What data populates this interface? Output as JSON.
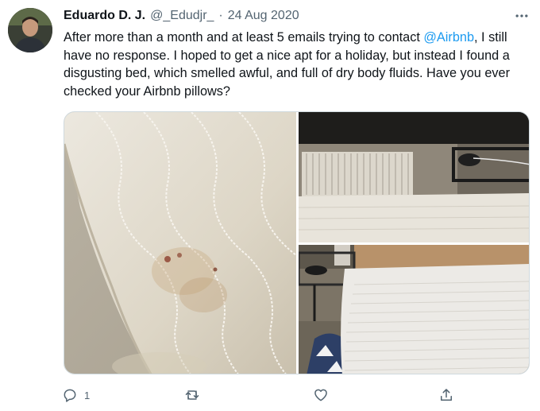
{
  "tweet": {
    "author": {
      "display_name": "Eduardo D. J.",
      "handle": "@_Edudjr_",
      "avatar_icon": "profile-photo"
    },
    "separator": "·",
    "date": "24 Aug 2020",
    "text": {
      "before_mention": "After more than a month and at least 5 emails trying to contact ",
      "mention": "@Airbnb",
      "after_mention": ", I still have no response. I hoped to get a nice apt for a holiday, but instead I found a disgusting bed, which smelled awful, and full of dry body fluids. Have you ever checked your Airbnb pillows?"
    },
    "media": {
      "photo_count": 3,
      "photos": [
        "stained-pillow-closeup",
        "bed-with-radiator",
        "bed-with-side-table"
      ]
    },
    "actions": {
      "reply_count": "1",
      "retweet_count": "",
      "like_count": ""
    },
    "colors": {
      "link": "#1d9bf0",
      "secondary_text": "#536471",
      "primary_text": "#0f1419"
    }
  }
}
